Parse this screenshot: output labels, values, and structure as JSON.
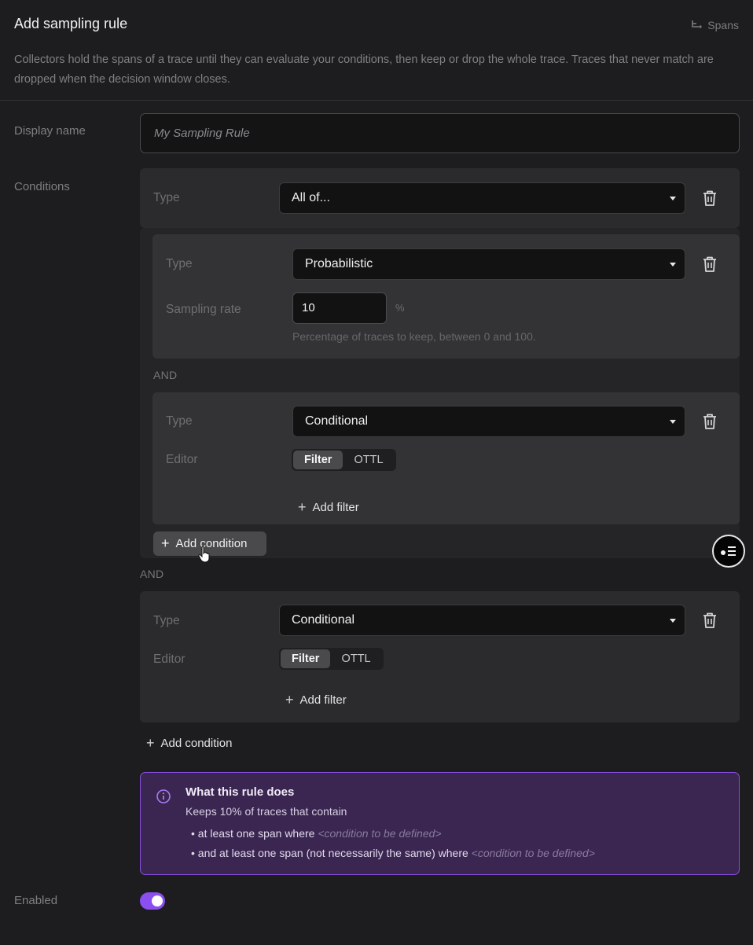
{
  "header": {
    "title": "Add sampling rule",
    "spans_link": "Spans",
    "description": "Collectors hold the spans of a trace until they can evaluate your conditions, then keep or drop the whole trace. Traces that never match are dropped when the decision window closes."
  },
  "form": {
    "display_name_label": "Display name",
    "display_name_placeholder": "My Sampling Rule",
    "conditions_label": "Conditions",
    "enabled_label": "Enabled",
    "enabled": true
  },
  "root_condition": {
    "type_label": "Type",
    "type_value": "All of..."
  },
  "nested": {
    "probabilistic": {
      "type_label": "Type",
      "type_value": "Probabilistic",
      "rate_label": "Sampling rate",
      "rate_value": "10",
      "rate_unit": "%",
      "rate_hint": "Percentage of traces to keep, between 0 and 100."
    },
    "and_label": "AND",
    "conditional": {
      "type_label": "Type",
      "type_value": "Conditional",
      "editor_label": "Editor",
      "editor_options": [
        "Filter",
        "OTTL"
      ],
      "add_filter": "Add filter"
    },
    "add_condition": "Add condition"
  },
  "outer_and_label": "AND",
  "second_conditional": {
    "type_label": "Type",
    "type_value": "Conditional",
    "editor_label": "Editor",
    "editor_options": [
      "Filter",
      "OTTL"
    ],
    "add_filter": "Add filter"
  },
  "add_condition": "Add condition",
  "summary": {
    "title": "What this rule does",
    "subtitle": "Keeps 10% of traces that contain",
    "item1_prefix": "at least one span where",
    "item1_placeholder": "<condition to be defined>",
    "item2_prefix": "and at least one span (not necessarily the same) where",
    "item2_placeholder": "<condition to be defined>"
  },
  "colors": {
    "accent": "#8b4ff0",
    "background": "#1d1d1f",
    "panel": "#2b2b2d",
    "summary_bg": "#3a2650"
  },
  "icons": [
    "spans-icon",
    "trash-icon",
    "plus-icon",
    "info-icon",
    "filter-list-icon",
    "pointer-cursor-icon"
  ]
}
